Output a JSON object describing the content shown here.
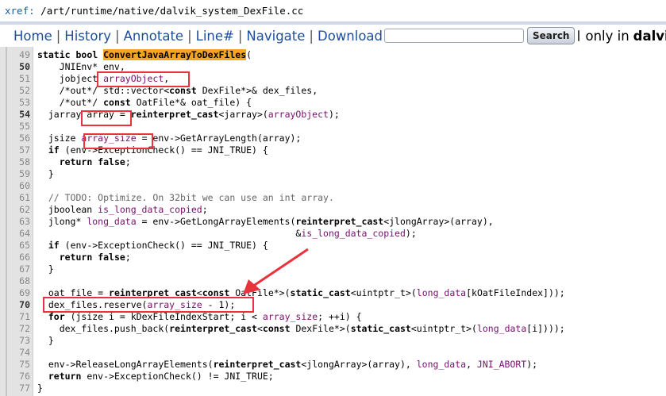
{
  "breadcrumb": {
    "label": "xref:",
    "path": "/art/runtime/native/dalvik_system_DexFile.cc"
  },
  "nav": {
    "home": "Home",
    "history": "History",
    "annotate": "Annotate",
    "line": "Line#",
    "navigate": "Navigate",
    "download": "Download",
    "separator": "|",
    "search_button": "Search",
    "search_value": "",
    "only_in_label": "only in",
    "only_in_value": "dalvik_s"
  },
  "colors": {
    "highlight": "#f5a623",
    "annotation": "#e8333d",
    "link": "#1d4e9e"
  },
  "code": {
    "lines": [
      {
        "n": "49",
        "t": "static bool ConvertJavaArrayToDexFiles("
      },
      {
        "n": "50",
        "t": "    JNIEnv* env,"
      },
      {
        "n": "51",
        "t": "    jobject arrayObject,"
      },
      {
        "n": "52",
        "t": "    /*out*/ std::vector<const DexFile*>& dex_files,"
      },
      {
        "n": "53",
        "t": "    /*out*/ const OatFile*& oat_file) {"
      },
      {
        "n": "54",
        "t": "  jarray array = reinterpret_cast<jarray>(arrayObject);"
      },
      {
        "n": "55",
        "t": ""
      },
      {
        "n": "56",
        "t": "  jsize array_size = env->GetArrayLength(array);"
      },
      {
        "n": "57",
        "t": "  if (env->ExceptionCheck() == JNI_TRUE) {"
      },
      {
        "n": "58",
        "t": "    return false;"
      },
      {
        "n": "59",
        "t": "  }"
      },
      {
        "n": "60",
        "t": ""
      },
      {
        "n": "61",
        "t": "  // TODO: Optimize. On 32bit we can use an int array."
      },
      {
        "n": "62",
        "t": "  jboolean is_long_data_copied;"
      },
      {
        "n": "63",
        "t": "  jlong* long_data = env->GetLongArrayElements(reinterpret_cast<jlongArray>(array),"
      },
      {
        "n": "64",
        "t": "                                               &is_long_data_copied);"
      },
      {
        "n": "65",
        "t": "  if (env->ExceptionCheck() == JNI_TRUE) {"
      },
      {
        "n": "66",
        "t": "    return false;"
      },
      {
        "n": "67",
        "t": "  }"
      },
      {
        "n": "68",
        "t": ""
      },
      {
        "n": "69",
        "t": "  oat_file = reinterpret_cast<const OatFile*>(static_cast<uintptr_t>(long_data[kOatFileIndex]));"
      },
      {
        "n": "70",
        "t": "  dex_files.reserve(array_size - 1);"
      },
      {
        "n": "71",
        "t": "  for (jsize i = kDexFileIndexStart; i < array_size; ++i) {"
      },
      {
        "n": "72",
        "t": "    dex_files.push_back(reinterpret_cast<const DexFile*>(static_cast<uintptr_t>(long_data[i])));"
      },
      {
        "n": "73",
        "t": "  }"
      },
      {
        "n": "74",
        "t": ""
      },
      {
        "n": "75",
        "t": "  env->ReleaseLongArrayElements(reinterpret_cast<jlongArray>(array), long_data, JNI_ABORT);"
      },
      {
        "n": "76",
        "t": "  return env->ExceptionCheck() != JNI_TRUE;"
      },
      {
        "n": "77",
        "t": "}"
      }
    ]
  }
}
